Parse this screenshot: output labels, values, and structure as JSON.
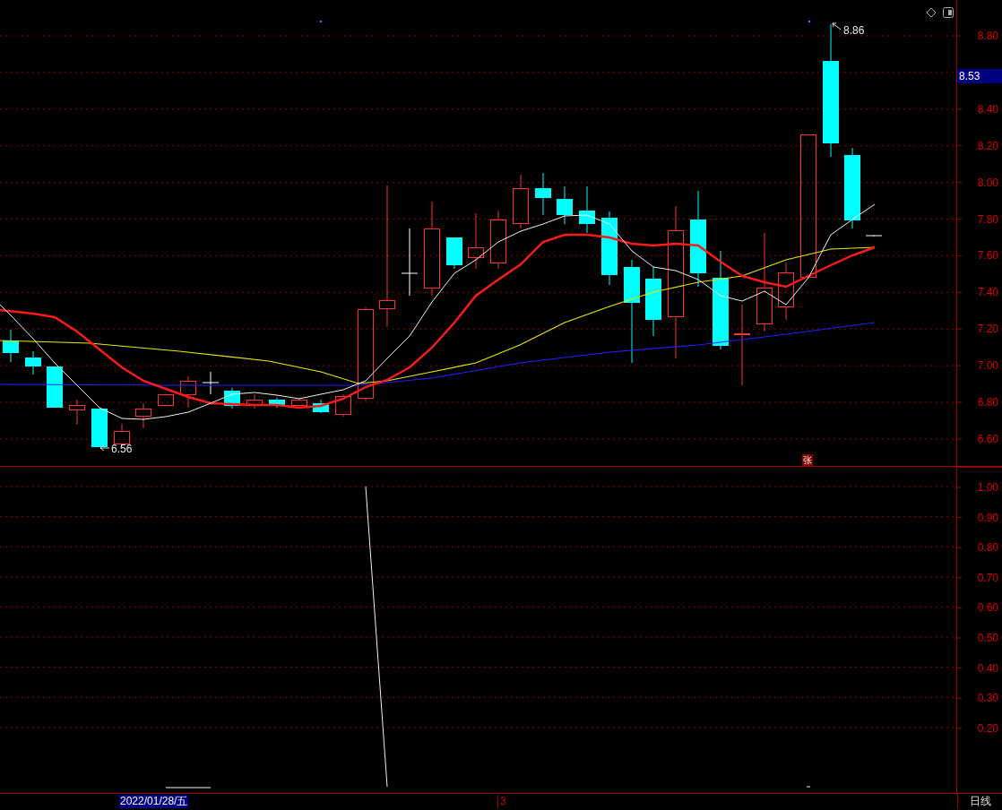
{
  "price_axis": {
    "ticks": [
      "8.80",
      "8.40",
      "8.20",
      "8.00",
      "7.80",
      "7.60",
      "7.40",
      "7.20",
      "7.00",
      "6.80",
      "6.60"
    ],
    "current_price": "8.53"
  },
  "price_chart": {
    "high_label": "8.86",
    "low_label": "6.56",
    "badge": "张"
  },
  "indicator_axis": {
    "ticks": [
      "1.00",
      "0.90",
      "0.80",
      "0.70",
      "0.60",
      "0.50",
      "0.40",
      "0.30",
      "0.20"
    ]
  },
  "time_axis": {
    "cursor_date": "2022/01/28/五",
    "month_mark": "3"
  },
  "period": "日线"
}
